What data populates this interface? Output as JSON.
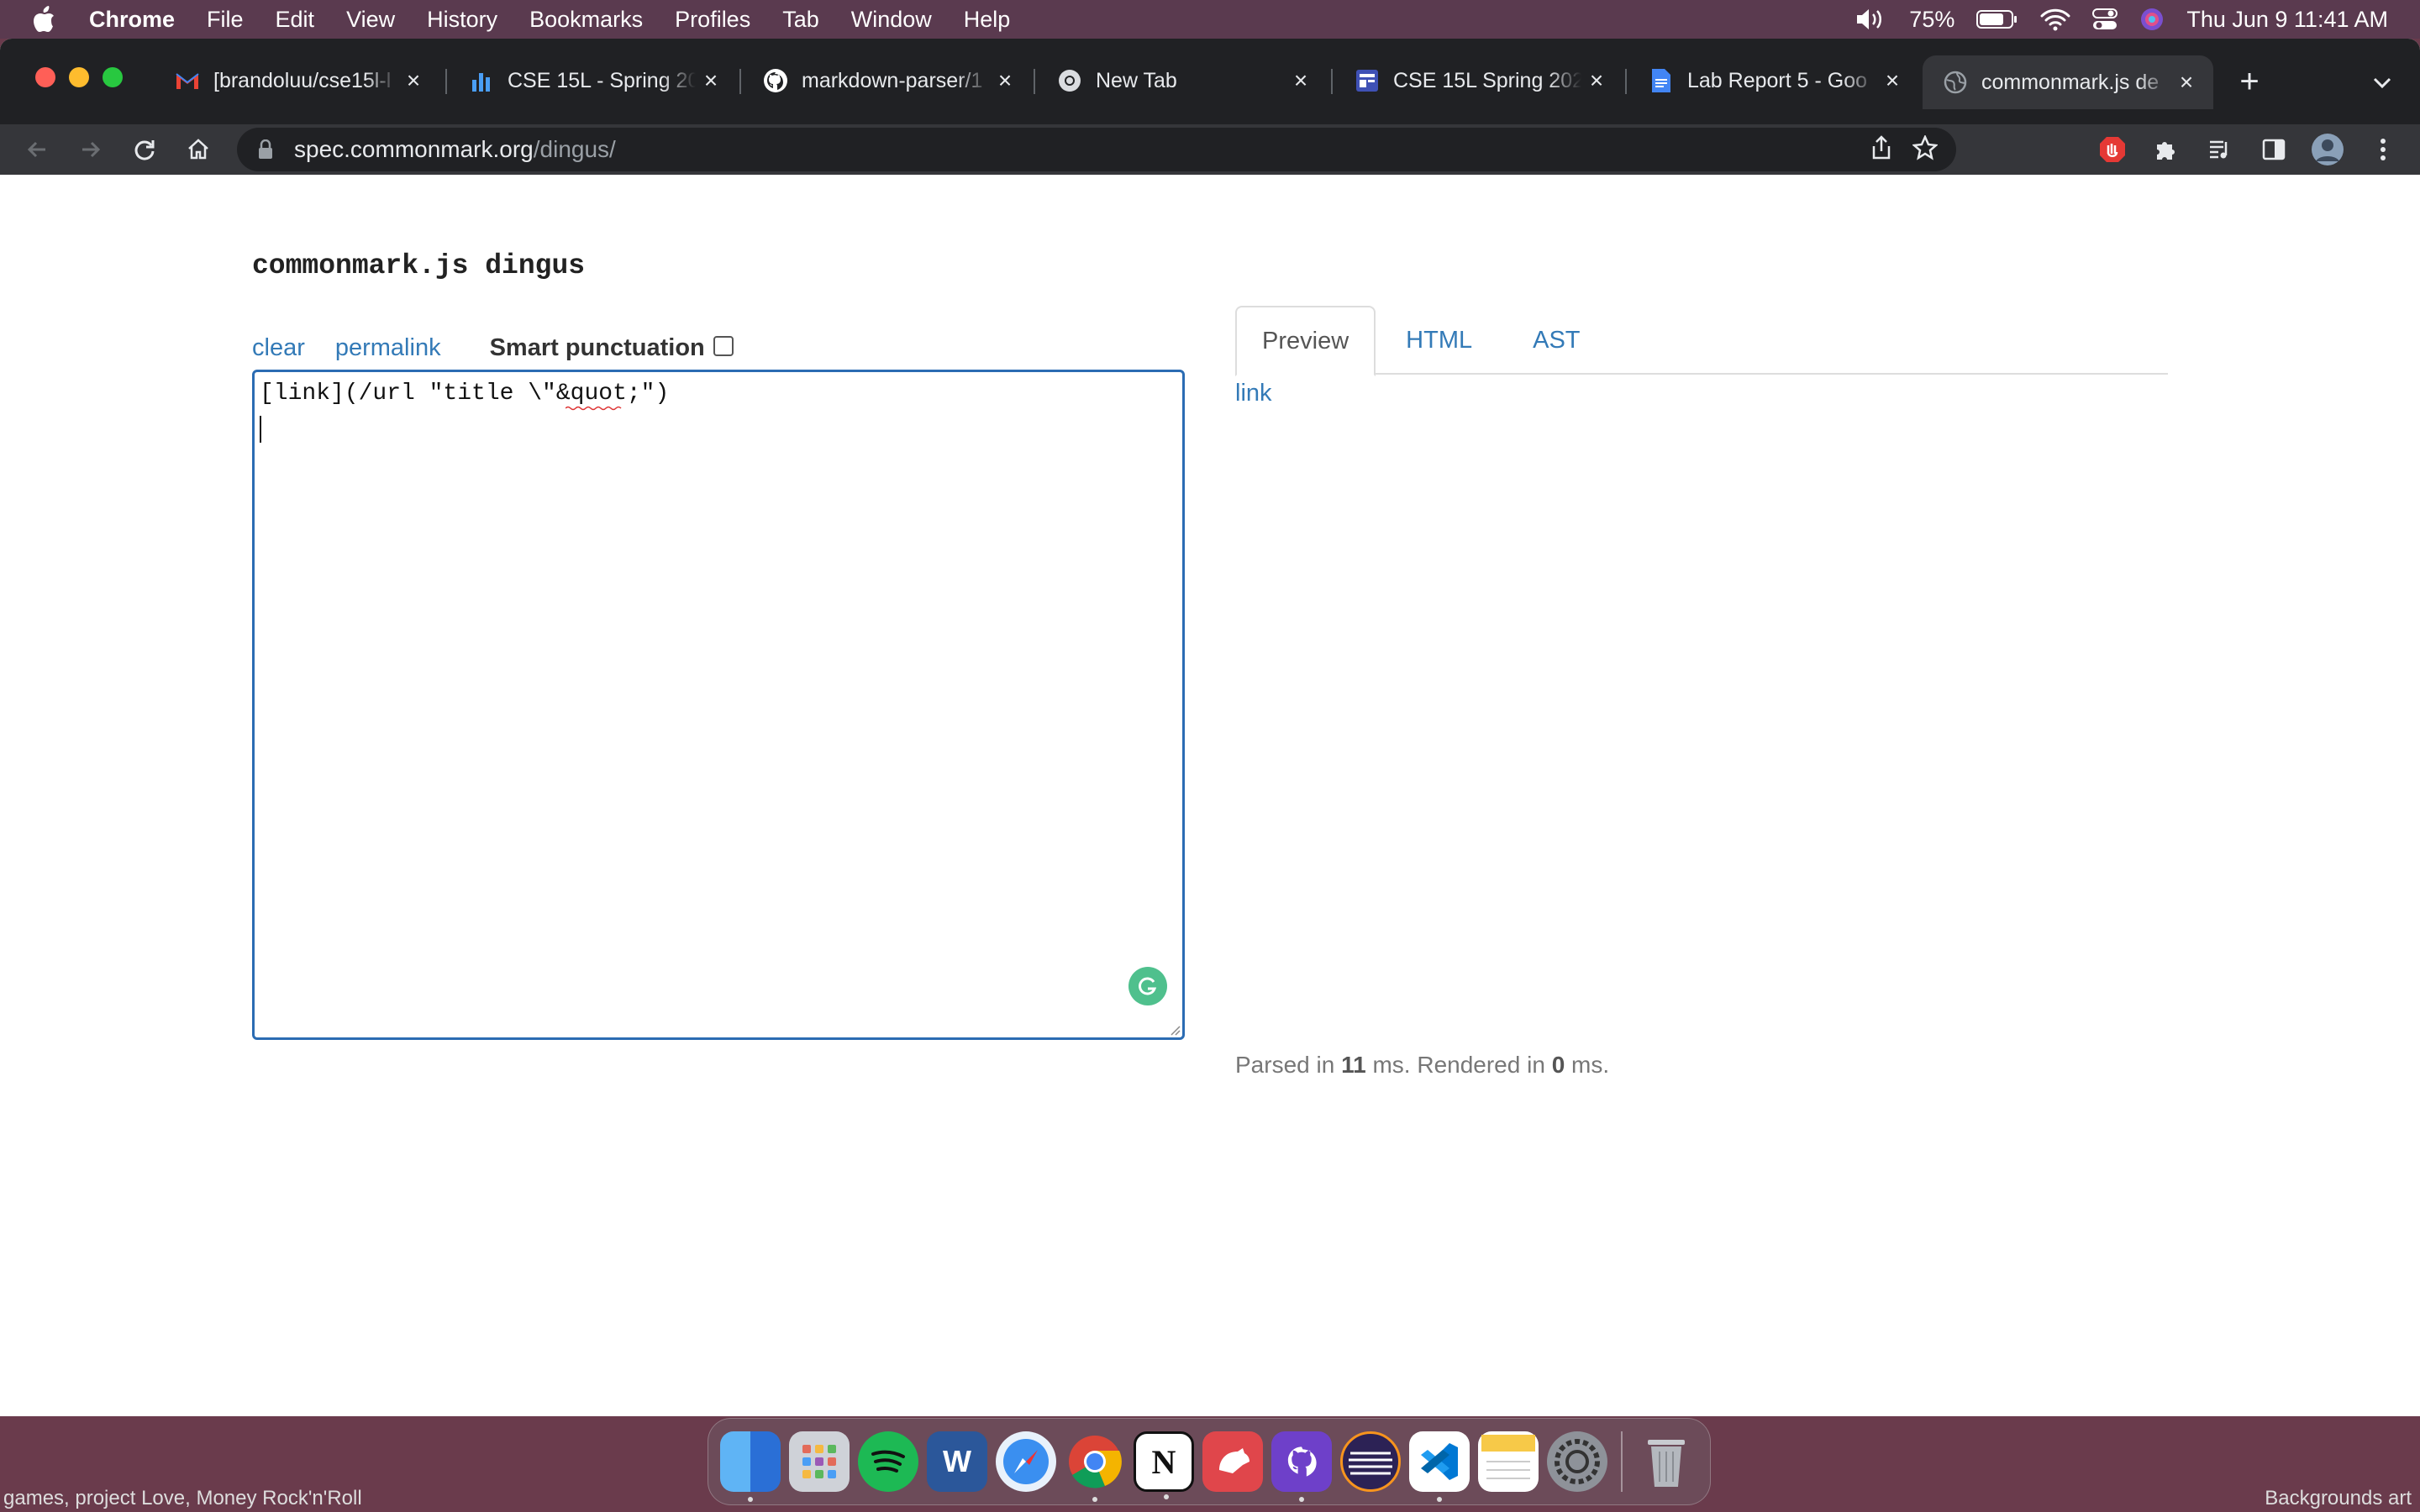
{
  "menubar": {
    "app": "Chrome",
    "items": [
      "File",
      "Edit",
      "View",
      "History",
      "Bookmarks",
      "Profiles",
      "Tab",
      "Window",
      "Help"
    ],
    "battery": "75%",
    "datetime": "Thu Jun 9  11:41 AM"
  },
  "tabs": [
    {
      "title": "[brandoluu/cse15l-l",
      "icon": "gmail-icon"
    },
    {
      "title": "CSE 15L - Spring 20",
      "icon": "chart-icon"
    },
    {
      "title": "markdown-parser/1",
      "icon": "github-icon"
    },
    {
      "title": "New Tab",
      "icon": "chrome-icon"
    },
    {
      "title": "CSE 15L Spring 202",
      "icon": "site-icon"
    },
    {
      "title": "Lab Report 5 - Goo",
      "icon": "docs-icon"
    },
    {
      "title": "commonmark.js de",
      "icon": "globe-icon"
    }
  ],
  "address": {
    "domain": "spec.commonmark.org",
    "path": "/dingus/"
  },
  "page": {
    "title": "commonmark.js dingus",
    "clear": "clear",
    "permalink": "permalink",
    "smart_punctuation": "Smart punctuation",
    "editor_text": "[link](/url \"title \\\"&quot;\")",
    "tabs": [
      "Preview",
      "HTML",
      "AST"
    ],
    "preview_link": "link",
    "timing": {
      "parsed_label": "Parsed in",
      "parsed_value": "11",
      "rendered_label": "ms. Rendered in",
      "rendered_value": "0",
      "suffix": "ms."
    }
  },
  "desktop": {
    "left_caption": "games, project Love, Money Rock'n'Roll",
    "right_caption": "Backgrounds art"
  },
  "dock": [
    "Finder",
    "Launchpad",
    "Spotify",
    "Word",
    "Safari",
    "Chrome",
    "Notion",
    "Bear",
    "GitHub Desktop",
    "Eclipse",
    "VS Code",
    "Notes",
    "System Preferences",
    "Trash"
  ]
}
